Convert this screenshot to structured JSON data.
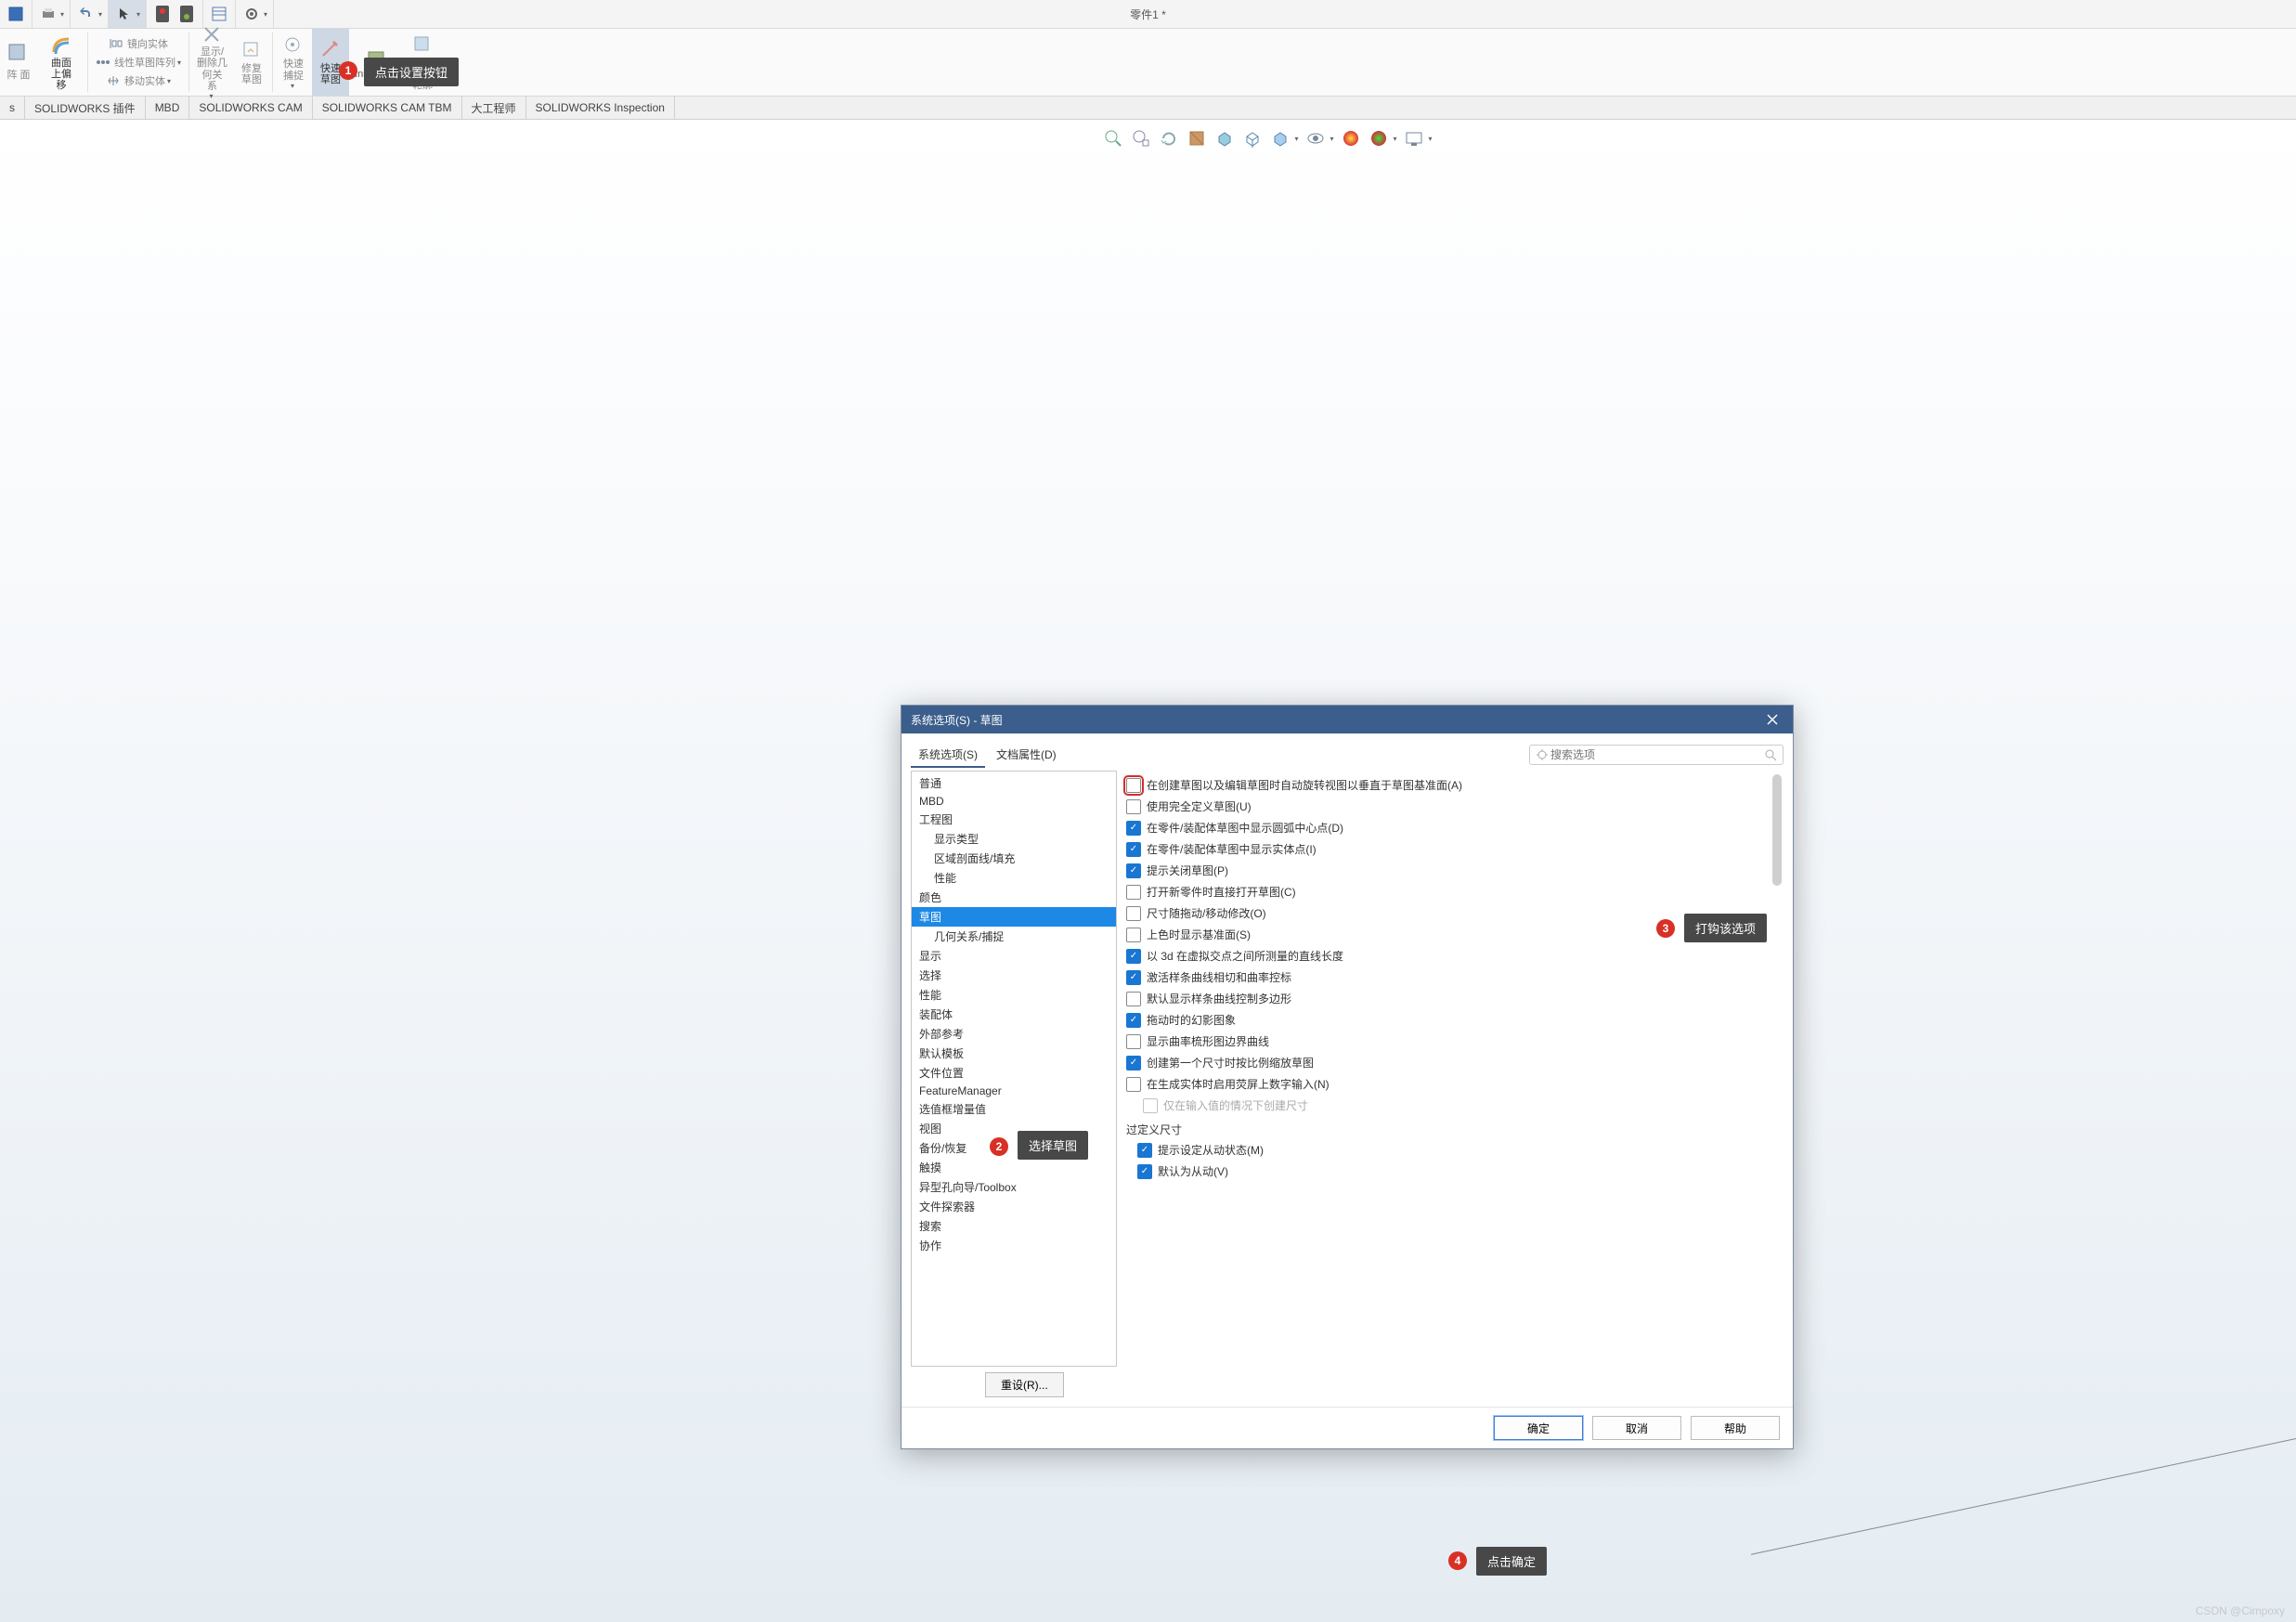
{
  "window": {
    "title": "零件1 *",
    "watermark": "CSDN @Cimpoxy"
  },
  "toolbar": {
    "icons": [
      "window",
      "print",
      "undo",
      "dropdown",
      "pointer",
      "dropdown",
      "traffic-red",
      "traffic-green",
      "panel",
      "gear",
      "dropdown"
    ]
  },
  "ribbon": {
    "items": [
      {
        "label": "阵\n面",
        "small": true
      },
      {
        "label": "曲面\n上偏\n移",
        "big": true
      },
      {
        "label": "镜向实体",
        "inline": true
      },
      {
        "label": "线性草图阵列",
        "inline": true,
        "arrow": true
      },
      {
        "label": "移动实体",
        "inline": true,
        "arrow": true
      },
      {
        "label": "显示/\n删除几\n何关\n系",
        "arrow": true
      },
      {
        "label": "修复\n草图"
      },
      {
        "label": "快速\n捕捉",
        "arrow": true
      },
      {
        "label": "快速\n草图",
        "sel": true
      },
      {
        "label": "Instant2D"
      },
      {
        "label": "上色\n草图\n轮廓"
      }
    ]
  },
  "tabs": [
    "s",
    "SOLIDWORKS 插件",
    "MBD",
    "SOLIDWORKS CAM",
    "SOLIDWORKS CAM TBM",
    "大工程师",
    "SOLIDWORKS Inspection"
  ],
  "viewIcons": [
    "zoom-fit",
    "zoom-area",
    "pan",
    "section",
    "box",
    "box2",
    "cube",
    "dropdown",
    "eye",
    "dropdown",
    "sphere",
    "sphere2",
    "dropdown",
    "monitor",
    "dropdown"
  ],
  "dialog": {
    "title": "系统选项(S) - 草图",
    "tabs": [
      "系统选项(S)",
      "文档属性(D)"
    ],
    "searchPlaceholder": "搜索选项",
    "tree": [
      {
        "t": "普通"
      },
      {
        "t": "MBD"
      },
      {
        "t": "工程图"
      },
      {
        "t": "显示类型",
        "sub": true
      },
      {
        "t": "区域剖面线/填充",
        "sub": true
      },
      {
        "t": "性能",
        "sub": true
      },
      {
        "t": "颜色"
      },
      {
        "t": "草图",
        "sel": true
      },
      {
        "t": "几何关系/捕捉",
        "sub": true
      },
      {
        "t": "显示"
      },
      {
        "t": "选择"
      },
      {
        "t": "性能"
      },
      {
        "t": "装配体"
      },
      {
        "t": "外部参考"
      },
      {
        "t": "默认模板"
      },
      {
        "t": "文件位置"
      },
      {
        "t": "FeatureManager"
      },
      {
        "t": "选值框增量值"
      },
      {
        "t": "视图"
      },
      {
        "t": "备份/恢复"
      },
      {
        "t": "触摸"
      },
      {
        "t": "异型孔向导/Toolbox"
      },
      {
        "t": "文件探索器"
      },
      {
        "t": "搜索"
      },
      {
        "t": "协作"
      }
    ],
    "options": [
      {
        "label": "在创建草图以及编辑草图时自动旋转视图以垂直于草图基准面(A)",
        "checked": false,
        "hl": true
      },
      {
        "label": "使用完全定义草图(U)",
        "checked": false
      },
      {
        "label": "在零件/装配体草图中显示圆弧中心点(D)",
        "checked": true
      },
      {
        "label": "在零件/装配体草图中显示实体点(I)",
        "checked": true
      },
      {
        "label": "提示关闭草图(P)",
        "checked": true
      },
      {
        "label": "打开新零件时直接打开草图(C)",
        "checked": false
      },
      {
        "label": "尺寸随拖动/移动修改(O)",
        "checked": false
      },
      {
        "label": "上色时显示基准面(S)",
        "checked": false
      },
      {
        "label": "以 3d 在虚拟交点之间所测量的直线长度",
        "checked": true
      },
      {
        "label": "激活样条曲线相切和曲率控标",
        "checked": true
      },
      {
        "label": "默认显示样条曲线控制多边形",
        "checked": false
      },
      {
        "label": "拖动时的幻影图象",
        "checked": true
      },
      {
        "label": "显示曲率梳形图边界曲线",
        "checked": false
      },
      {
        "label": "创建第一个尺寸时按比例缩放草图",
        "checked": true
      },
      {
        "label": "在生成实体时启用荧屏上数字输入(N)",
        "checked": false
      },
      {
        "label": "仅在输入值的情况下创建尺寸",
        "checked": false,
        "sub": true,
        "disabled": true
      }
    ],
    "groupLabel": "过定义尺寸",
    "groupOptions": [
      {
        "label": "提示设定从动状态(M)",
        "checked": true
      },
      {
        "label": "默认为从动(V)",
        "checked": true
      }
    ],
    "reset": "重设(R)...",
    "buttons": {
      "ok": "确定",
      "cancel": "取消",
      "help": "帮助"
    }
  },
  "callouts": {
    "c1": "点击设置按钮",
    "c2": "选择草图",
    "c3": "打钩该选项",
    "c4": "点击确定"
  }
}
